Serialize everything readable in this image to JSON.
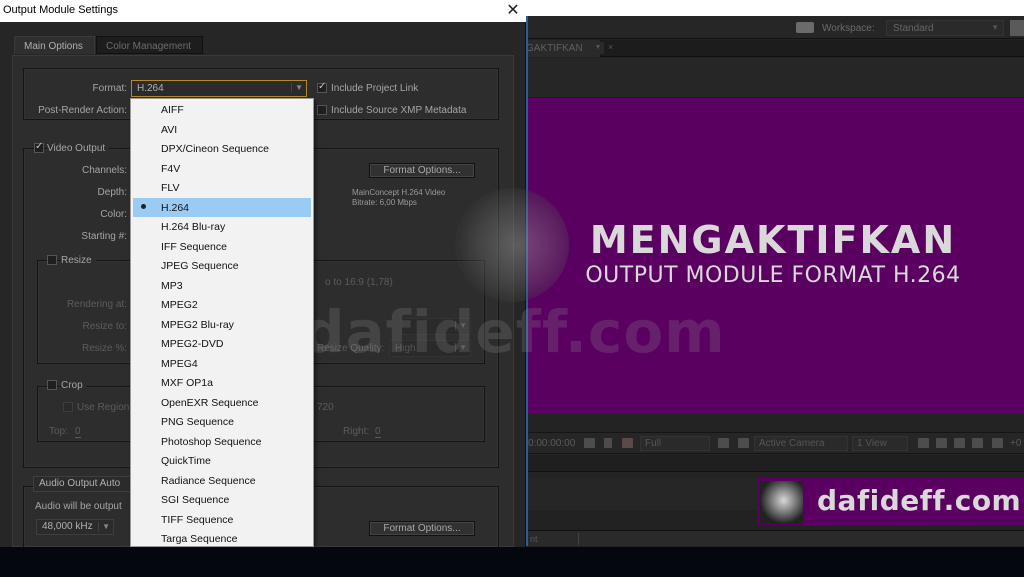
{
  "dialog": {
    "title": "Output Module Settings",
    "close_glyph": "✕",
    "tabs": [
      {
        "label": "Main Options",
        "active": true
      },
      {
        "label": "Color Management",
        "active": false
      }
    ],
    "format": {
      "label": "Format:",
      "value": "H.264",
      "arrow": "▼"
    },
    "post_render": {
      "label": "Post-Render Action:"
    },
    "include_project_link": {
      "label": "Include Project Link",
      "checked": true
    },
    "include_xmp": {
      "label": "Include Source XMP Metadata",
      "checked": false
    },
    "video_output": {
      "label": "Video Output",
      "checked": true,
      "channels_label": "Channels:",
      "depth_label": "Depth:",
      "color_label": "Color:",
      "starting_label": "Starting #:",
      "format_options_label": "Format Options...",
      "codec_info_line1": "MainConcept H.264 Video",
      "codec_info_line2": "Bitrate: 6,00 Mbps"
    },
    "resize": {
      "label": "Resize",
      "checked": false,
      "aspect_text": "o to 16:9 (1,78)",
      "rendering_at_label": "Rendering at:",
      "resize_to_label": "Resize to:",
      "resize_pct_label": "Resize %:",
      "resize_quality_label": "Resize Quality:",
      "resize_quality_value": "High"
    },
    "crop": {
      "label": "Crop",
      "checked": false,
      "use_region_label": "Use Region",
      "size_text": "720",
      "top_label": "Top:",
      "top_value": "0",
      "right_label": "Right:",
      "right_value": "0"
    },
    "audio": {
      "output_label": "Audio Output Auto",
      "note": "Audio will be output",
      "sample_rate": "48,000 kHz",
      "format_options_label": "Format Options..."
    }
  },
  "format_dropdown": {
    "selected": "H.264",
    "items": [
      "AIFF",
      "AVI",
      "DPX/Cineon Sequence",
      "F4V",
      "FLV",
      "H.264",
      "H.264 Blu-ray",
      "IFF Sequence",
      "JPEG Sequence",
      "MP3",
      "MPEG2",
      "MPEG2 Blu-ray",
      "MPEG2-DVD",
      "MPEG4",
      "MXF OP1a",
      "OpenEXR Sequence",
      "PNG Sequence",
      "Photoshop Sequence",
      "QuickTime",
      "Radiance Sequence",
      "SGI Sequence",
      "TIFF Sequence",
      "Targa Sequence"
    ]
  },
  "app": {
    "workspace_label": "Workspace:",
    "workspace_value": "Standard",
    "comp_tab_label": "GAKTIFKAN",
    "comp_tab_close": "×",
    "viewer": {
      "timecode": "0:00:00:00",
      "resolution": "Full",
      "camera": "Active Camera",
      "views": "1 View",
      "exposure": "+0"
    },
    "status_text": "nt"
  },
  "composition": {
    "headline": "MENGAKTIFKAN",
    "subheadline": "OUTPUT MODULE FORMAT H.264",
    "background_color": "#5a0060"
  },
  "branding": {
    "watermark": "dafideff.com",
    "badge_text": "dafideff.com"
  }
}
